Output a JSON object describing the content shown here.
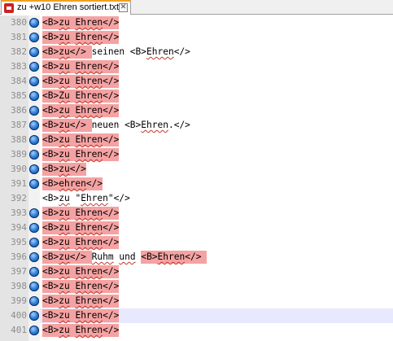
{
  "tab": {
    "label": "zu +w10 Ehren sortiert.txt",
    "close": "✕"
  },
  "colors": {
    "highlight": "#f5a2a2",
    "current_line": "#e8e8ff",
    "gutter": "#e4e4e4"
  },
  "lines": [
    {
      "num": "380",
      "segments": [
        {
          "text": "<B>",
          "hl": true
        },
        {
          "text": "zu",
          "hl": true,
          "u": true
        },
        {
          "text": " ",
          "hl": true
        },
        {
          "text": "Ehren",
          "hl": true,
          "u": true
        },
        {
          "text": "</>",
          "hl": true
        }
      ]
    },
    {
      "num": "381",
      "segments": [
        {
          "text": "<B>",
          "hl": true
        },
        {
          "text": "zu",
          "hl": true,
          "u": true
        },
        {
          "text": " ",
          "hl": true
        },
        {
          "text": "Ehren",
          "hl": true,
          "u": true
        },
        {
          "text": "</>",
          "hl": true
        }
      ]
    },
    {
      "num": "382",
      "segments": [
        {
          "text": "<B>",
          "hl": true
        },
        {
          "text": "zu",
          "hl": true,
          "u": true
        },
        {
          "text": "</> ",
          "hl": true
        },
        {
          "text": "seinen <B>",
          "hl": false
        },
        {
          "text": "Ehren",
          "hl": false,
          "u": true
        },
        {
          "text": "</>",
          "hl": false
        }
      ]
    },
    {
      "num": "383",
      "segments": [
        {
          "text": "<B>",
          "hl": true
        },
        {
          "text": "zu",
          "hl": true,
          "u": true
        },
        {
          "text": " ",
          "hl": true
        },
        {
          "text": "Ehren",
          "hl": true,
          "u": true
        },
        {
          "text": "</>",
          "hl": true
        }
      ]
    },
    {
      "num": "384",
      "segments": [
        {
          "text": "<B>",
          "hl": true
        },
        {
          "text": "zu",
          "hl": true,
          "u": true
        },
        {
          "text": " ",
          "hl": true
        },
        {
          "text": "Ehren",
          "hl": true,
          "u": true
        },
        {
          "text": "</>",
          "hl": true
        }
      ]
    },
    {
      "num": "385",
      "segments": [
        {
          "text": "<B>",
          "hl": true
        },
        {
          "text": "Zu",
          "hl": true,
          "u": true
        },
        {
          "text": " ",
          "hl": true
        },
        {
          "text": "Ehren",
          "hl": true,
          "u": true
        },
        {
          "text": "</>",
          "hl": true
        }
      ]
    },
    {
      "num": "386",
      "segments": [
        {
          "text": "<B>",
          "hl": true
        },
        {
          "text": "zu",
          "hl": true,
          "u": true
        },
        {
          "text": " ",
          "hl": true
        },
        {
          "text": "Ehren",
          "hl": true,
          "u": true
        },
        {
          "text": "</>",
          "hl": true
        }
      ]
    },
    {
      "num": "387",
      "segments": [
        {
          "text": "<B>",
          "hl": true
        },
        {
          "text": "zu",
          "hl": true,
          "u": true
        },
        {
          "text": "</> ",
          "hl": true
        },
        {
          "text": "neuen <B>",
          "hl": false
        },
        {
          "text": "Ehren",
          "hl": false,
          "u": true
        },
        {
          "text": ".</>",
          "hl": false
        }
      ]
    },
    {
      "num": "388",
      "segments": [
        {
          "text": "<B>",
          "hl": true
        },
        {
          "text": "zu",
          "hl": true,
          "u": true
        },
        {
          "text": " ",
          "hl": true
        },
        {
          "text": "Ehren",
          "hl": true,
          "u": true
        },
        {
          "text": "</>",
          "hl": true
        }
      ]
    },
    {
      "num": "389",
      "segments": [
        {
          "text": "<B>",
          "hl": true
        },
        {
          "text": "zu",
          "hl": true,
          "u": true
        },
        {
          "text": " ",
          "hl": true
        },
        {
          "text": "Ehren",
          "hl": true,
          "u": true
        },
        {
          "text": "</>",
          "hl": true
        }
      ]
    },
    {
      "num": "390",
      "segments": [
        {
          "text": "<B>",
          "hl": true
        },
        {
          "text": "zu",
          "hl": true,
          "u": true
        },
        {
          "text": "</>",
          "hl": true
        }
      ]
    },
    {
      "num": "391",
      "segments": [
        {
          "text": "<B>",
          "hl": true
        },
        {
          "text": "ehren",
          "hl": true,
          "u": true
        },
        {
          "text": "</>",
          "hl": true
        }
      ]
    },
    {
      "num": "392",
      "noglobe": true,
      "segments": [
        {
          "text": "<B>",
          "hl": false
        },
        {
          "text": "zu",
          "hl": false,
          "u": true
        },
        {
          "text": " \"",
          "hl": false
        },
        {
          "text": "Ehren",
          "hl": false,
          "u": true
        },
        {
          "text": "\"</>",
          "hl": false
        }
      ]
    },
    {
      "num": "393",
      "segments": [
        {
          "text": "<B>",
          "hl": true
        },
        {
          "text": "zu",
          "hl": true,
          "u": true
        },
        {
          "text": " ",
          "hl": true
        },
        {
          "text": "Ehren",
          "hl": true,
          "u": true
        },
        {
          "text": "</>",
          "hl": true
        }
      ]
    },
    {
      "num": "394",
      "segments": [
        {
          "text": "<B>",
          "hl": true
        },
        {
          "text": "zu",
          "hl": true,
          "u": true
        },
        {
          "text": " ",
          "hl": true
        },
        {
          "text": "Ehren",
          "hl": true,
          "u": true
        },
        {
          "text": "</>",
          "hl": true
        }
      ]
    },
    {
      "num": "395",
      "segments": [
        {
          "text": "<B>",
          "hl": true
        },
        {
          "text": "zu",
          "hl": true,
          "u": true
        },
        {
          "text": " ",
          "hl": true
        },
        {
          "text": "Ehren",
          "hl": true,
          "u": true
        },
        {
          "text": "</>",
          "hl": true
        }
      ]
    },
    {
      "num": "396",
      "segments": [
        {
          "text": "<B>",
          "hl": true
        },
        {
          "text": "zu",
          "hl": true,
          "u": true
        },
        {
          "text": "</> ",
          "hl": true
        },
        {
          "text": "Ruhm",
          "hl": false,
          "u": true
        },
        {
          "text": " ",
          "hl": false
        },
        {
          "text": "und",
          "hl": false,
          "u": true
        },
        {
          "text": " ",
          "hl": false
        },
        {
          "text": "<B>",
          "hl": true
        },
        {
          "text": "Ehren",
          "hl": true,
          "u": true
        },
        {
          "text": "</> ",
          "hl": true
        }
      ]
    },
    {
      "num": "397",
      "segments": [
        {
          "text": "<B>",
          "hl": true
        },
        {
          "text": "zu",
          "hl": true,
          "u": true
        },
        {
          "text": " ",
          "hl": true
        },
        {
          "text": "Ehren",
          "hl": true,
          "u": true
        },
        {
          "text": "</>",
          "hl": true
        }
      ]
    },
    {
      "num": "398",
      "segments": [
        {
          "text": "<B>",
          "hl": true
        },
        {
          "text": "zu",
          "hl": true,
          "u": true
        },
        {
          "text": " ",
          "hl": true
        },
        {
          "text": "Ehren",
          "hl": true,
          "u": true
        },
        {
          "text": "</>",
          "hl": true
        }
      ]
    },
    {
      "num": "399",
      "segments": [
        {
          "text": "<B>",
          "hl": true
        },
        {
          "text": "zu",
          "hl": true,
          "u": true
        },
        {
          "text": " ",
          "hl": true
        },
        {
          "text": "Ehren",
          "hl": true,
          "u": true
        },
        {
          "text": "</>",
          "hl": true
        }
      ]
    },
    {
      "num": "400",
      "current": true,
      "segments": [
        {
          "text": "<B>",
          "hl": true
        },
        {
          "text": "zu",
          "hl": true,
          "u": true
        },
        {
          "text": " ",
          "hl": true
        },
        {
          "text": "Ehren",
          "hl": true,
          "u": true
        },
        {
          "text": "</>",
          "hl": true
        }
      ]
    },
    {
      "num": "401",
      "segments": [
        {
          "text": "<B>",
          "hl": true
        },
        {
          "text": "zu",
          "hl": true,
          "u": true
        },
        {
          "text": " ",
          "hl": true
        },
        {
          "text": "Ehren",
          "hl": true,
          "u": true
        },
        {
          "text": "</>",
          "hl": true
        }
      ]
    }
  ]
}
